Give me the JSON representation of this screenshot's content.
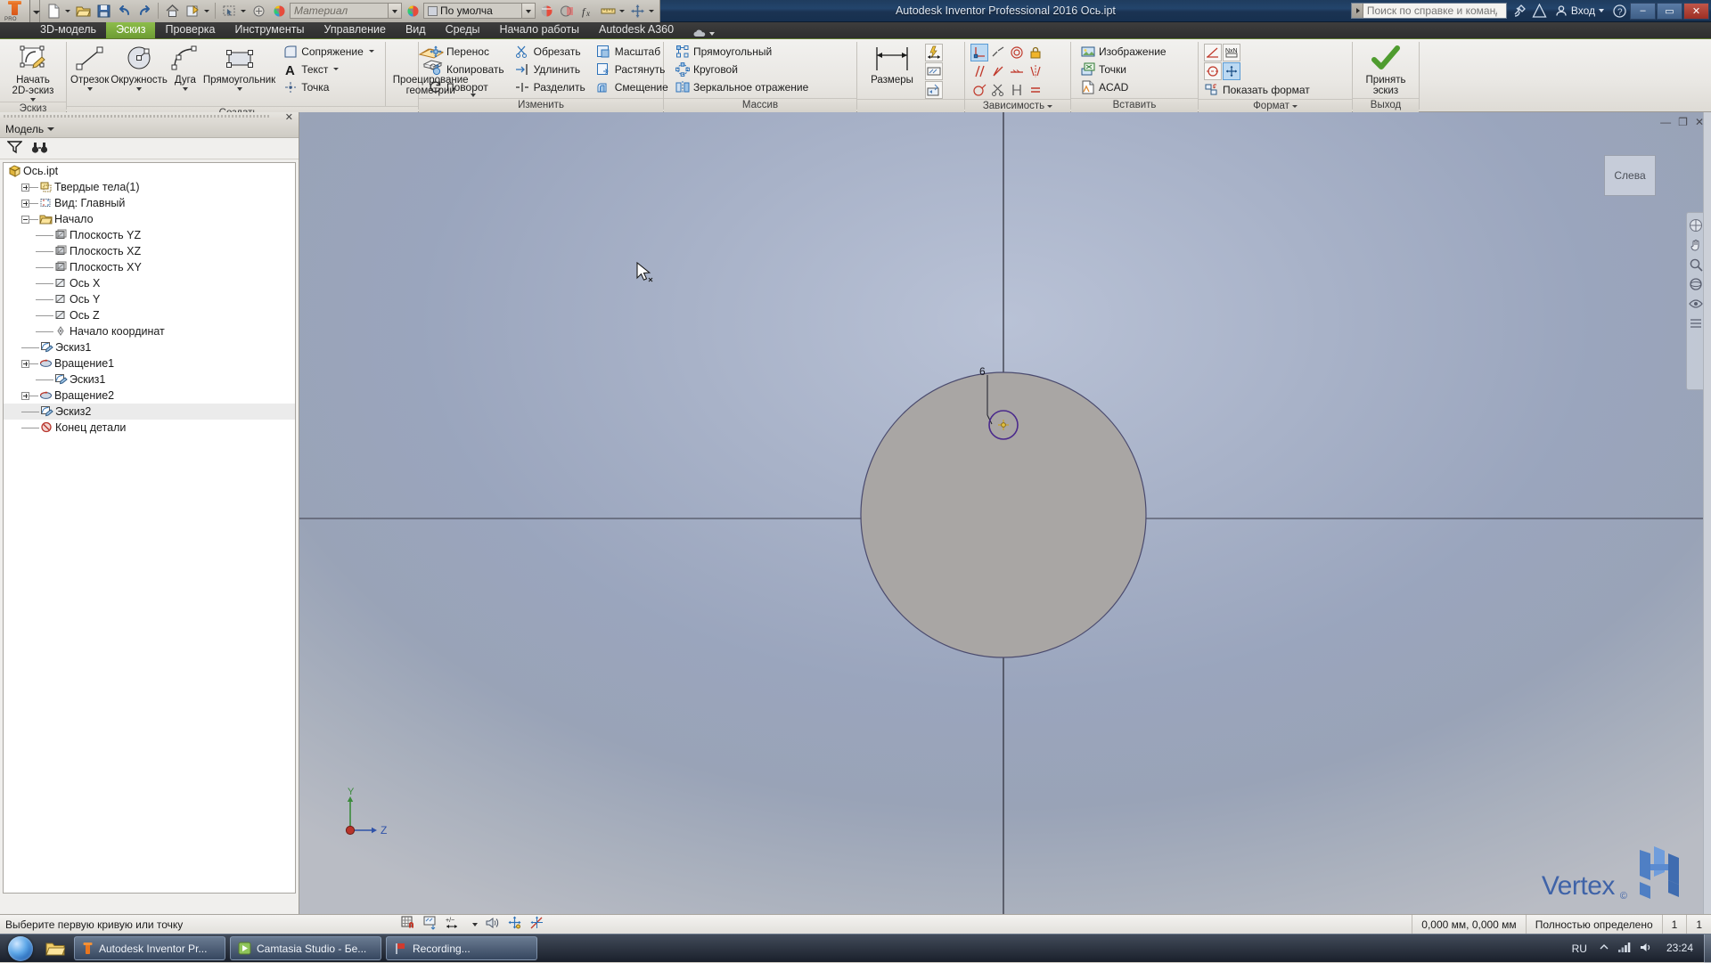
{
  "titlebar": {
    "app_title": "Autodesk Inventor Professional 2016",
    "document_name": "Ось.ipt",
    "full_title": "Autodesk Inventor Professional 2016   Ось.ipt",
    "search_placeholder": "Поиск по справке и командам.",
    "signin_label": "Вход",
    "material_placeholder": "Материал",
    "appearance_value": "По умолча",
    "logo_text": "PRO",
    "window_controls": {
      "minimize": "–",
      "maximize": "▭",
      "close": "✕"
    }
  },
  "tabs": [
    {
      "label": "3D-модель",
      "active": false
    },
    {
      "label": "Эскиз",
      "active": true
    },
    {
      "label": "Проверка",
      "active": false
    },
    {
      "label": "Инструменты",
      "active": false
    },
    {
      "label": "Управление",
      "active": false
    },
    {
      "label": "Вид",
      "active": false
    },
    {
      "label": "Среды",
      "active": false
    },
    {
      "label": "Начало работы",
      "active": false
    },
    {
      "label": "Autodesk A360",
      "active": false
    }
  ],
  "ribbon": {
    "panels": [
      {
        "title": "Эскиз",
        "big": [
          {
            "label": "Начать\n2D-эскиз"
          }
        ]
      },
      {
        "title": "Создать",
        "big": [
          {
            "label": "Отрезок"
          },
          {
            "label": "Окружность"
          },
          {
            "label": "Дуга"
          },
          {
            "label": "Прямоугольник"
          }
        ],
        "small": [
          {
            "label": "Сопряжение"
          },
          {
            "label": "Текст"
          },
          {
            "label": "Точка"
          }
        ],
        "big2": [
          {
            "label": "Проецирование\nгеометрии"
          }
        ]
      },
      {
        "title": "Изменить",
        "col1": [
          {
            "label": "Перенос"
          },
          {
            "label": "Копировать"
          },
          {
            "label": "Поворот"
          }
        ],
        "col2": [
          {
            "label": "Обрезать"
          },
          {
            "label": "Удлинить"
          },
          {
            "label": "Разделить"
          }
        ],
        "col3": [
          {
            "label": "Масштаб"
          },
          {
            "label": "Растянуть"
          },
          {
            "label": "Смещение"
          }
        ]
      },
      {
        "title": "Массив",
        "col1": [
          {
            "label": "Прямоугольный"
          },
          {
            "label": "Круговой"
          },
          {
            "label": "Зеркальное отражение"
          }
        ]
      },
      {
        "title": "",
        "big": [
          {
            "label": "Размеры"
          }
        ]
      },
      {
        "title": "Зависимость"
      },
      {
        "title": "Вставить",
        "col1": [
          {
            "label": "Изображение"
          },
          {
            "label": "Точки"
          },
          {
            "label": "ACAD"
          }
        ]
      },
      {
        "title": "Формат",
        "col1": [
          {
            "label": "Показать формат"
          }
        ]
      },
      {
        "title": "Выход",
        "big": [
          {
            "label": "Принять\nэскиз"
          }
        ]
      }
    ]
  },
  "browser": {
    "panel_title": "Модель",
    "filter_icon": "filter-icon",
    "search_icon": "binoculars-icon",
    "close_icon": "close-icon",
    "tree": [
      {
        "label": "Ось.ipt",
        "depth": 0,
        "expander": "none",
        "icon": "part-icon",
        "hl": false
      },
      {
        "label": "Твердые тела(1)",
        "depth": 1,
        "expander": "plus",
        "icon": "solids-icon",
        "hl": false
      },
      {
        "label": "Вид: Главный",
        "depth": 1,
        "expander": "plus",
        "icon": "view-icon",
        "hl": false
      },
      {
        "label": "Начало",
        "depth": 1,
        "expander": "minus",
        "icon": "folder-icon",
        "hl": false
      },
      {
        "label": "Плоскость YZ",
        "depth": 2,
        "expander": "none",
        "icon": "plane-icon",
        "hl": false
      },
      {
        "label": "Плоскость XZ",
        "depth": 2,
        "expander": "none",
        "icon": "plane-icon",
        "hl": false
      },
      {
        "label": "Плоскость XY",
        "depth": 2,
        "expander": "none",
        "icon": "plane-icon",
        "hl": false
      },
      {
        "label": "Ось X",
        "depth": 2,
        "expander": "none",
        "icon": "axis-icon",
        "hl": false
      },
      {
        "label": "Ось Y",
        "depth": 2,
        "expander": "none",
        "icon": "axis-icon",
        "hl": false
      },
      {
        "label": "Ось Z",
        "depth": 2,
        "expander": "none",
        "icon": "axis-icon",
        "hl": false
      },
      {
        "label": "Начало координат",
        "depth": 2,
        "expander": "none",
        "icon": "origin-icon",
        "hl": false
      },
      {
        "label": "Эскиз1",
        "depth": 1,
        "expander": "none",
        "icon": "sketch-icon",
        "hl": false
      },
      {
        "label": "Вращение1",
        "depth": 1,
        "expander": "plus",
        "icon": "revolve-icon",
        "hl": false
      },
      {
        "label": "Эскиз1",
        "depth": 2,
        "expander": "none",
        "icon": "sketch-icon",
        "hl": false
      },
      {
        "label": "Вращение2",
        "depth": 1,
        "expander": "plus",
        "icon": "revolve-icon",
        "hl": false
      },
      {
        "label": "Эскиз2",
        "depth": 1,
        "expander": "none",
        "icon": "sketch-icon",
        "hl": true
      },
      {
        "label": "Конец детали",
        "depth": 1,
        "expander": "none",
        "icon": "end-part-icon",
        "hl": false
      }
    ]
  },
  "viewport": {
    "viewcube_label": "Слева",
    "dimension_label": "6",
    "watermark_text": "Vertex",
    "watermark_reg": "©",
    "axis_labels": {
      "y": "Y",
      "z": "Z"
    },
    "colors": {
      "background_top": "#b9c2d6",
      "background_bottom": "#b9bcc4",
      "body_fill": "#a9a6a4",
      "body_edge": "#4a4a6a",
      "sketch_circle": "#4b2a8c",
      "axis_line": "#2b2b3a"
    }
  },
  "statusbar": {
    "message": "Выберите первую кривую или точку",
    "coordinates": "0,000 мм, 0,000 мм",
    "constraint_state": "Полностью определено",
    "count_a": "1",
    "count_b": "1",
    "icons": [
      "grid-snap-icon",
      "dim-display-icon",
      "tolerance-icon",
      "speaker-icon",
      "degrees-of-freedom-icon",
      "constraint-icon"
    ]
  },
  "taskbar": {
    "start_label": "start-orb",
    "quick_launch": "explorer-icon",
    "items": [
      {
        "label": "Autodesk Inventor Pr...",
        "icon": "inventor-icon",
        "active": true
      },
      {
        "label": "Camtasia Studio - Бе...",
        "icon": "camtasia-icon",
        "active": false
      },
      {
        "label": "Recording...",
        "icon": "recording-icon",
        "active": false
      }
    ],
    "language": "RU",
    "clock_time": "23:24"
  }
}
